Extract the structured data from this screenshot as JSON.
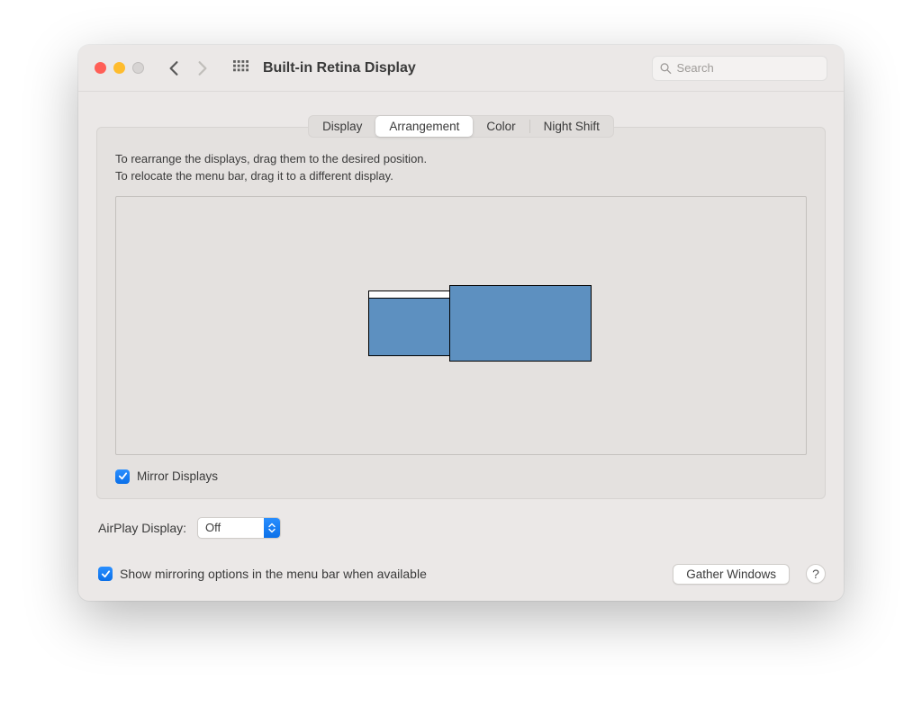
{
  "window": {
    "title": "Built-in Retina Display"
  },
  "search": {
    "placeholder": "Search"
  },
  "tabs": {
    "display": "Display",
    "arrangement": "Arrangement",
    "color": "Color",
    "night_shift": "Night Shift",
    "active": "arrangement"
  },
  "instructions": {
    "line1": "To rearrange the displays, drag them to the desired position.",
    "line2": "To relocate the menu bar, drag it to a different display."
  },
  "mirror_label": "Mirror Displays",
  "mirror_checked": true,
  "airplay": {
    "label": "AirPlay Display:",
    "value": "Off"
  },
  "show_mirroring": {
    "label": "Show mirroring options in the menu bar when available",
    "checked": true
  },
  "gather_button": "Gather Windows",
  "help_button": "?"
}
